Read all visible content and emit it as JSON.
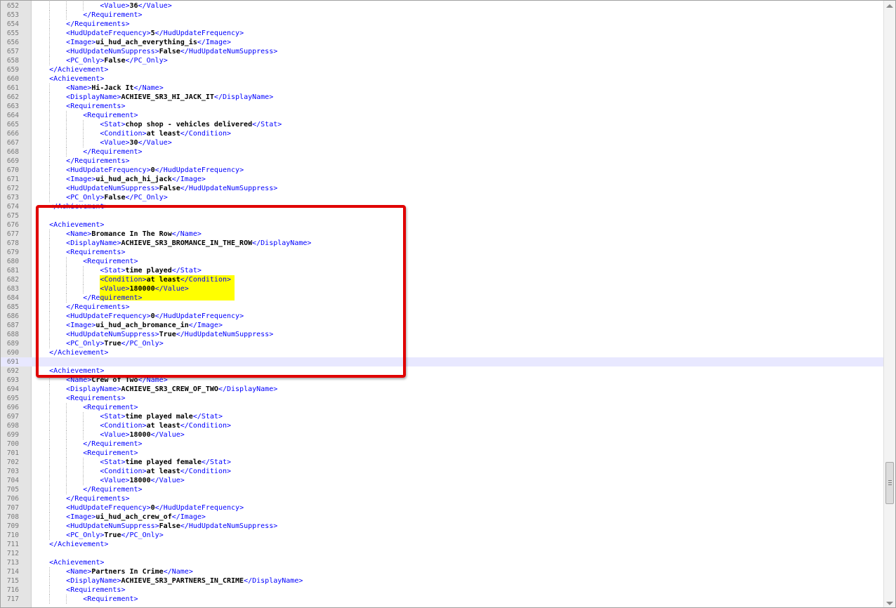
{
  "editor": {
    "lines": [
      {
        "n": "652",
        "d": 3,
        "t": "Value",
        "v": "36"
      },
      {
        "n": "653",
        "d": 2,
        "c": "Requirement"
      },
      {
        "n": "654",
        "d": 1,
        "c": "Requirements"
      },
      {
        "n": "655",
        "d": 1,
        "t": "HudUpdateFrequency",
        "v": "5"
      },
      {
        "n": "656",
        "d": 1,
        "t": "Image",
        "v": "ui_hud_ach_everything_is"
      },
      {
        "n": "657",
        "d": 1,
        "t": "HudUpdateNumSuppress",
        "v": "False"
      },
      {
        "n": "658",
        "d": 1,
        "t": "PC_Only",
        "v": "False"
      },
      {
        "n": "659",
        "d": 0,
        "c": "Achievement"
      },
      {
        "n": "660",
        "d": 0,
        "o": "Achievement"
      },
      {
        "n": "661",
        "d": 1,
        "t": "Name",
        "v": "Hi-Jack It"
      },
      {
        "n": "662",
        "d": 1,
        "t": "DisplayName",
        "v": "ACHIEVE_SR3_HI_JACK_IT"
      },
      {
        "n": "663",
        "d": 1,
        "o": "Requirements"
      },
      {
        "n": "664",
        "d": 2,
        "o": "Requirement"
      },
      {
        "n": "665",
        "d": 3,
        "t": "Stat",
        "v": "chop shop - vehicles delivered"
      },
      {
        "n": "666",
        "d": 3,
        "t": "Condition",
        "v": "at least"
      },
      {
        "n": "667",
        "d": 3,
        "t": "Value",
        "v": "30"
      },
      {
        "n": "668",
        "d": 2,
        "c": "Requirement"
      },
      {
        "n": "669",
        "d": 1,
        "c": "Requirements"
      },
      {
        "n": "670",
        "d": 1,
        "t": "HudUpdateFrequency",
        "v": "0"
      },
      {
        "n": "671",
        "d": 1,
        "t": "Image",
        "v": "ui_hud_ach_hi_jack"
      },
      {
        "n": "672",
        "d": 1,
        "t": "HudUpdateNumSuppress",
        "v": "False"
      },
      {
        "n": "673",
        "d": 1,
        "t": "PC_Only",
        "v": "False"
      },
      {
        "n": "674",
        "d": 0,
        "c": "Achievement"
      },
      {
        "n": "675",
        "d": 0
      },
      {
        "n": "676",
        "d": 0,
        "o": "Achievement"
      },
      {
        "n": "677",
        "d": 1,
        "t": "Name",
        "v": "Bromance In The Row"
      },
      {
        "n": "678",
        "d": 1,
        "t": "DisplayName",
        "v": "ACHIEVE_SR3_BROMANCE_IN_THE_ROW"
      },
      {
        "n": "679",
        "d": 1,
        "o": "Requirements"
      },
      {
        "n": "680",
        "d": 2,
        "o": "Requirement"
      },
      {
        "n": "681",
        "d": 3,
        "t": "Stat",
        "v": "time played"
      },
      {
        "n": "682",
        "d": 3,
        "t": "Condition",
        "v": "at least"
      },
      {
        "n": "683",
        "d": 3,
        "t": "Value",
        "v": "180000"
      },
      {
        "n": "684",
        "d": 2,
        "c": "Requirement"
      },
      {
        "n": "685",
        "d": 1,
        "c": "Requirements"
      },
      {
        "n": "686",
        "d": 1,
        "t": "HudUpdateFrequency",
        "v": "0"
      },
      {
        "n": "687",
        "d": 1,
        "t": "Image",
        "v": "ui_hud_ach_bromance_in"
      },
      {
        "n": "688",
        "d": 1,
        "t": "HudUpdateNumSuppress",
        "v": "True"
      },
      {
        "n": "689",
        "d": 1,
        "t": "PC_Only",
        "v": "True"
      },
      {
        "n": "690",
        "d": 0,
        "c": "Achievement"
      },
      {
        "n": "691",
        "d": 0,
        "current": true
      },
      {
        "n": "692",
        "d": 0,
        "o": "Achievement"
      },
      {
        "n": "693",
        "d": 1,
        "t": "Name",
        "v": "Crew of Two"
      },
      {
        "n": "694",
        "d": 1,
        "t": "DisplayName",
        "v": "ACHIEVE_SR3_CREW_OF_TWO"
      },
      {
        "n": "695",
        "d": 1,
        "o": "Requirements"
      },
      {
        "n": "696",
        "d": 2,
        "o": "Requirement"
      },
      {
        "n": "697",
        "d": 3,
        "t": "Stat",
        "v": "time played male"
      },
      {
        "n": "698",
        "d": 3,
        "t": "Condition",
        "v": "at least"
      },
      {
        "n": "699",
        "d": 3,
        "t": "Value",
        "v": "18000"
      },
      {
        "n": "700",
        "d": 2,
        "c": "Requirement"
      },
      {
        "n": "701",
        "d": 2,
        "o": "Requirement"
      },
      {
        "n": "702",
        "d": 3,
        "t": "Stat",
        "v": "time played female"
      },
      {
        "n": "703",
        "d": 3,
        "t": "Condition",
        "v": "at least"
      },
      {
        "n": "704",
        "d": 3,
        "t": "Value",
        "v": "18000"
      },
      {
        "n": "705",
        "d": 2,
        "c": "Requirement"
      },
      {
        "n": "706",
        "d": 1,
        "c": "Requirements"
      },
      {
        "n": "707",
        "d": 1,
        "t": "HudUpdateFrequency",
        "v": "0"
      },
      {
        "n": "708",
        "d": 1,
        "t": "Image",
        "v": "ui_hud_ach_crew_of"
      },
      {
        "n": "709",
        "d": 1,
        "t": "HudUpdateNumSuppress",
        "v": "False"
      },
      {
        "n": "710",
        "d": 1,
        "t": "PC_Only",
        "v": "True"
      },
      {
        "n": "711",
        "d": 0,
        "c": "Achievement"
      },
      {
        "n": "712",
        "d": 0
      },
      {
        "n": "713",
        "d": 0,
        "o": "Achievement"
      },
      {
        "n": "714",
        "d": 1,
        "t": "Name",
        "v": "Partners In Crime"
      },
      {
        "n": "715",
        "d": 1,
        "t": "DisplayName",
        "v": "ACHIEVE_SR3_PARTNERS_IN_CRIME"
      },
      {
        "n": "716",
        "d": 1,
        "o": "Requirements"
      },
      {
        "n": "717",
        "d": 2,
        "o": "Requirement"
      }
    ]
  },
  "annotations": {
    "highlight_color": "#ffff00",
    "box_color": "#e00000",
    "highlighted_lines": [
      "682",
      "683",
      "684"
    ],
    "boxed_lines": [
      "675",
      "692"
    ]
  },
  "colors": {
    "tag": "#0000ff",
    "value": "#000000",
    "gutter": "#e4e4e4",
    "current_line": "#e8e8ff"
  }
}
